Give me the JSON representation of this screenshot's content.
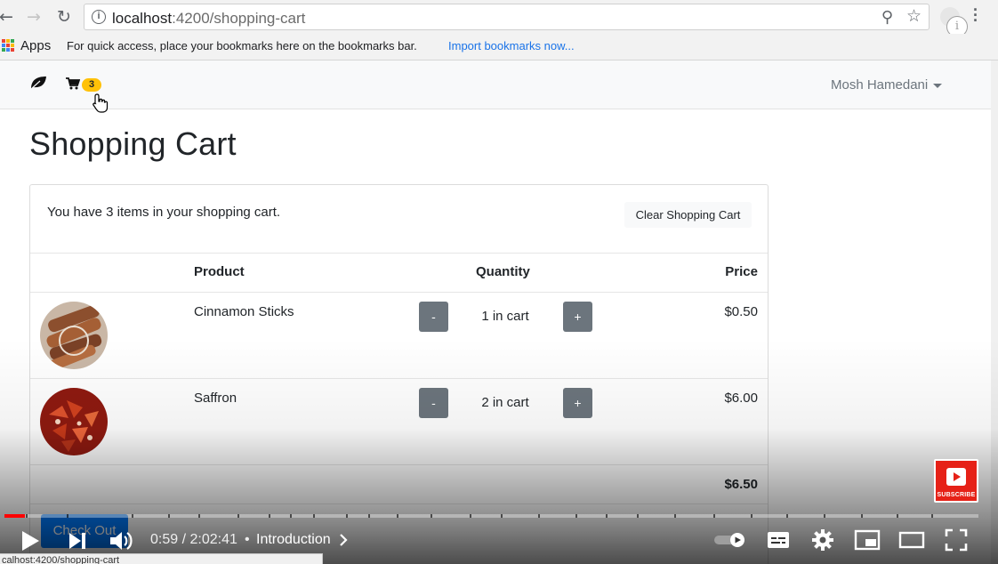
{
  "browser": {
    "url_host": "localhost",
    "url_path": ":4200/shopping-cart",
    "back_icon": "arrow-left-icon",
    "forward_icon": "arrow-right-icon",
    "reload_icon": "reload-icon",
    "bookmarks": {
      "apps_label": "Apps",
      "hint": "For quick access, place your bookmarks here on the bookmarks bar.",
      "import_link": "Import bookmarks now..."
    }
  },
  "navbar": {
    "cart_count": "3",
    "user_name": "Mosh Hamedani"
  },
  "page": {
    "title": "Shopping Cart",
    "summary": "You have 3 items in your shopping cart.",
    "clear_button": "Clear Shopping Cart",
    "columns": {
      "product": "Product",
      "quantity": "Quantity",
      "price": "Price"
    },
    "items": [
      {
        "name": "Cinnamon Sticks",
        "quantity_text": "1 in cart",
        "price": "$0.50",
        "minus": "-",
        "plus": "+"
      },
      {
        "name": "Saffron",
        "quantity_text": "2 in cart",
        "price": "$6.00",
        "minus": "-",
        "plus": "+"
      }
    ],
    "total": "$6.50",
    "checkout_button": "Check Out"
  },
  "video": {
    "time": "0:59 / 2:02:41",
    "separator": "•",
    "chapter": "Introduction",
    "progress_fraction": 0.021,
    "subscribe_label": "SUBSCRIBE"
  },
  "status_bar": {
    "url": "calhost:4200/shopping-cart"
  },
  "colors": {
    "accent": "#007bff",
    "badge": "#ffc107",
    "qty_button": "#6c757d",
    "progress": "#ff0000",
    "subscribe": "#e62117"
  }
}
